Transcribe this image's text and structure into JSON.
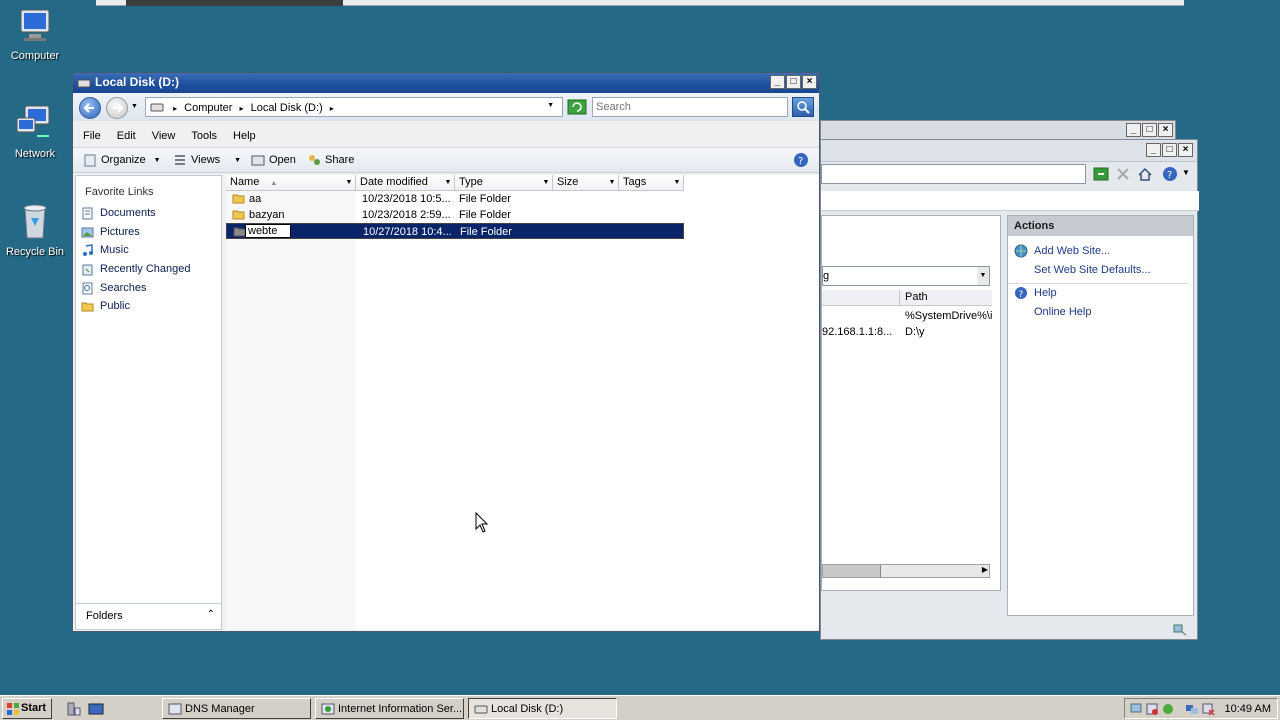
{
  "desktop": {
    "icons": [
      {
        "label": "Computer"
      },
      {
        "label": "Network"
      },
      {
        "label": "Recycle Bin"
      }
    ]
  },
  "iis": {
    "actions_header": "Actions",
    "actions": [
      {
        "label": "Add Web Site..."
      },
      {
        "label": "Set Web Site Defaults..."
      },
      {
        "label": "Help"
      },
      {
        "label": "Online Help"
      }
    ],
    "dropdown_value": "g",
    "path_header": "Path",
    "rows": [
      {
        "binding": "",
        "path": "%SystemDrive%\\i"
      },
      {
        "binding": "92.168.1.1:8...",
        "path": "D:\\y"
      }
    ]
  },
  "explorer": {
    "title": "Local Disk (D:)",
    "breadcrumb": [
      "Computer",
      "Local Disk (D:)"
    ],
    "search_placeholder": "Search",
    "menu": [
      "File",
      "Edit",
      "View",
      "Tools",
      "Help"
    ],
    "commands": {
      "organize": "Organize",
      "views": "Views",
      "open": "Open",
      "share": "Share"
    },
    "favorites_header": "Favorite Links",
    "favorites": [
      "Documents",
      "Pictures",
      "Music",
      "Recently Changed",
      "Searches",
      "Public"
    ],
    "folders_label": "Folders",
    "columns": {
      "name": "Name",
      "date": "Date modified",
      "type": "Type",
      "size": "Size",
      "tags": "Tags"
    },
    "files": [
      {
        "name": "aa",
        "date": "10/23/2018 10:5...",
        "type": "File Folder"
      },
      {
        "name": "bazyan",
        "date": "10/23/2018 2:59...",
        "type": "File Folder"
      },
      {
        "name": "webte",
        "date": "10/27/2018 10:4...",
        "type": "File Folder"
      }
    ]
  },
  "taskbar": {
    "start": "Start",
    "tasks": [
      {
        "label": "DNS Manager"
      },
      {
        "label": "Internet Information Ser..."
      },
      {
        "label": "Local Disk (D:)"
      }
    ],
    "clock": "10:49 AM"
  },
  "colors": {
    "desktop": "#246a86",
    "titlebar": "#1e4f9b",
    "selection": "#0a246a",
    "link": "#1e3b8a"
  }
}
